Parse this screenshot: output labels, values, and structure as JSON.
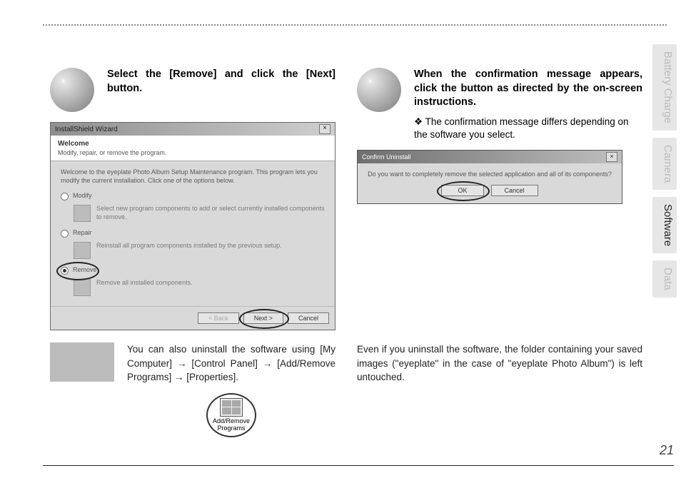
{
  "tabs": {
    "battery": "Battery Charge",
    "camera": "Camera",
    "software": "Software",
    "data": "Data"
  },
  "page_number": "21",
  "left": {
    "heading": "Select the [Remove] and click the [Next] button.",
    "dialog": {
      "title": "InstallShield Wizard",
      "header_title": "Welcome",
      "header_sub": "Modify, repair, or remove the program.",
      "body_msg": "Welcome to the eyeplate Photo Album Setup Maintenance program. This program lets you modify the current installation. Click one of the options below.",
      "opt_modify": "Modify",
      "opt_modify_desc": "Select new program components to add or select currently installed components to remove.",
      "opt_repair": "Repair",
      "opt_repair_desc": "Reinstall all program components installed by the previous setup.",
      "opt_remove": "Remove",
      "opt_remove_desc": "Remove all installed components.",
      "btn_back": "< Back",
      "btn_next": "Next >",
      "btn_cancel": "Cancel"
    }
  },
  "right": {
    "heading": "When the confirmation message appears, click the button as directed by the on-screen instructions.",
    "note_prefix": "❖",
    "note": "The confirmation message differs depending on the software you select.",
    "dialog": {
      "title": "Confirm Uninstall",
      "msg": "Do you want to completely remove the selected application and all of its components?",
      "btn_ok": "OK",
      "btn_cancel": "Cancel"
    }
  },
  "bottom_left": {
    "text_pre": "You can also uninstall the software using [My Computer] → [Control Panel] → [Add/Remove Programs] → [Properties].",
    "icon_label1": "Add/Remove",
    "icon_label2": "Programs"
  },
  "bottom_right": {
    "text": "Even if you uninstall the software, the folder containing your saved images (\"eyeplate\" in the case of \"eyeplate Photo Album\") is left untouched."
  }
}
